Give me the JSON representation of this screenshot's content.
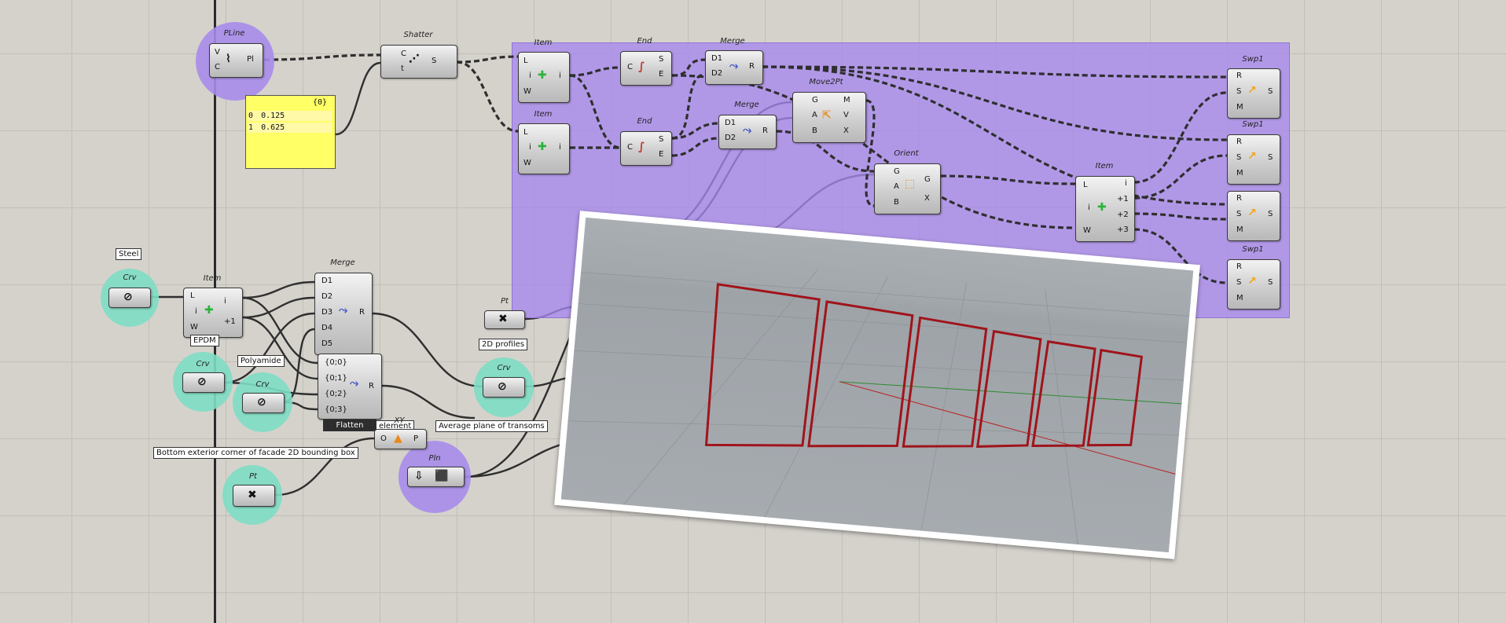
{
  "canvas": {
    "background": "#d5d2cc",
    "group_color": "#a788ee",
    "param_bubble_color": "#7eddc4",
    "panel_color": "#ffff66"
  },
  "components": {
    "pline": {
      "title": "PLine",
      "inputs": [
        "V",
        "C"
      ],
      "outputs": [
        "Pl"
      ],
      "icon": "polyline-icon"
    },
    "shatter": {
      "title": "Shatter",
      "inputs": [
        "C",
        "t"
      ],
      "outputs": [
        "S"
      ],
      "icon": "shatter-icon"
    },
    "item_a": {
      "title": "Item",
      "inputs": [
        "L",
        "i",
        "W"
      ],
      "outputs": [
        "i"
      ],
      "icon": "list-item-icon"
    },
    "item_b": {
      "title": "Item",
      "inputs": [
        "L",
        "i",
        "W"
      ],
      "outputs": [
        "i"
      ],
      "icon": "list-item-icon"
    },
    "end_a": {
      "title": "End",
      "inputs": [
        "C"
      ],
      "outputs": [
        "S",
        "E"
      ],
      "icon": "curve-end-icon"
    },
    "end_b": {
      "title": "End",
      "inputs": [
        "C"
      ],
      "outputs": [
        "S",
        "E"
      ],
      "icon": "curve-end-icon"
    },
    "merge_a": {
      "title": "Merge",
      "inputs": [
        "D1",
        "D2"
      ],
      "outputs": [
        "R"
      ],
      "icon": "merge-icon"
    },
    "merge_b": {
      "title": "Merge",
      "inputs": [
        "D1",
        "D2"
      ],
      "outputs": [
        "R"
      ],
      "icon": "merge-icon"
    },
    "move2pt": {
      "title": "Move2Pt",
      "inputs": [
        "G",
        "A",
        "B"
      ],
      "outputs": [
        "M",
        "V",
        "X"
      ],
      "icon": "move-icon"
    },
    "orient": {
      "title": "Orient",
      "inputs": [
        "G",
        "A",
        "B"
      ],
      "outputs": [
        "G",
        "X"
      ],
      "icon": "orient-icon"
    },
    "item_c": {
      "title": "Item",
      "inputs": [
        "L",
        "i",
        "W"
      ],
      "outputs": [
        "i",
        "+1",
        "+2",
        "+3"
      ],
      "icon": "list-item-icon"
    },
    "swp1": {
      "title": "Swp1",
      "inputs": [
        "R",
        "S",
        "M"
      ],
      "outputs": [
        "S"
      ],
      "icon": "sweep-icon",
      "count": 4
    },
    "item_d": {
      "title": "Item",
      "inputs": [
        "L",
        "i",
        "W"
      ],
      "outputs": [
        "i",
        "+1"
      ],
      "icon": "list-item-icon"
    },
    "merge_c": {
      "title": "Merge",
      "inputs": [
        "D1",
        "D2",
        "D3",
        "D4",
        "D5"
      ],
      "outputs": [
        "R"
      ],
      "icon": "merge-icon"
    },
    "flatten_merge": {
      "inputs": [
        "{0;0}",
        "{0;1}",
        "{0;2}",
        "{0;3}"
      ],
      "outputs": [
        "R"
      ],
      "icon": "merge-icon"
    },
    "pt_top": {
      "title": "Pt"
    },
    "xy_plane": {
      "title": "XY",
      "inputs": [
        "O"
      ],
      "outputs": [
        "P"
      ],
      "icon": "xy-plane-icon"
    }
  },
  "params": {
    "crv_steel": {
      "title": "Crv"
    },
    "crv_epdm": {
      "title": "Crv"
    },
    "crv_polyamide": {
      "title": "Crv"
    },
    "crv_2d": {
      "title": "Crv"
    },
    "pt_bottom": {
      "title": "Pt"
    },
    "pln": {
      "title": "Pln"
    }
  },
  "panel": {
    "header": "{0}",
    "rows": [
      {
        "index": "0",
        "value": "0.125"
      },
      {
        "index": "1",
        "value": "0.625"
      }
    ]
  },
  "labels": {
    "steel": "Steel",
    "epdm": "EPDM",
    "polyamide": "Polyamide",
    "profiles_2d": "2D profiles",
    "flatten": "Flatten",
    "element": "element",
    "average_plane": "Average plane of transoms",
    "bottom_corner": "Bottom exterior corner of facade 2D bounding box"
  }
}
